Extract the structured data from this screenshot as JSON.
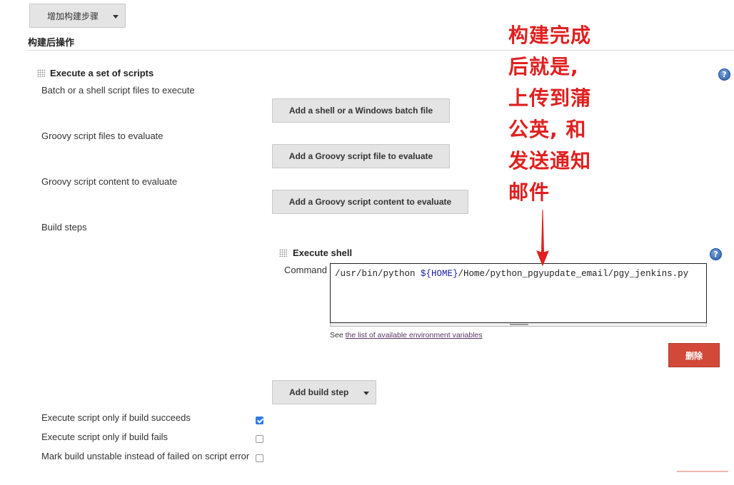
{
  "top": {
    "add_step_label": "增加构建步骤",
    "section_title": "构建后操作"
  },
  "scripts_block": {
    "title": "Execute a set of scripts",
    "help": "?",
    "rows": [
      {
        "label": "Batch or a shell script files to execute",
        "button": "Add a shell or a Windows batch file"
      },
      {
        "label": "Groovy script files to evaluate",
        "button": "Add a Groovy script file to evaluate"
      },
      {
        "label": "Groovy script content to evaluate",
        "button": "Add a Groovy script content to evaluate"
      }
    ],
    "build_steps_label": "Build steps"
  },
  "execute_shell": {
    "title": "Execute shell",
    "help": "?",
    "command_label": "Command",
    "command_prefix": "/usr/bin/python ",
    "command_var": "${HOME}",
    "command_suffix": "/Home/python_pgyupdate_email/pgy_jenkins.py",
    "see_text": "See ",
    "env_link": "the list of available environment variables",
    "delete_label": "删除"
  },
  "add_build_step_label": "Add build step",
  "options": [
    {
      "label": "Execute script only if build succeeds",
      "checked": true
    },
    {
      "label": "Execute script only if build fails",
      "checked": false
    },
    {
      "label": "Mark build unstable instead of failed on script error",
      "checked": false
    }
  ],
  "annotation": {
    "lines": [
      "构建完成",
      "后就是,",
      "上传到蒲",
      "公英, 和",
      "发送通知",
      "邮件"
    ],
    "color": "#e02020"
  },
  "colors": {
    "button_bg": "#e4e4e4",
    "delete_bg": "#d24939",
    "checkbox_on": "#2d7be5",
    "help_icon": "#2a5aa8"
  }
}
